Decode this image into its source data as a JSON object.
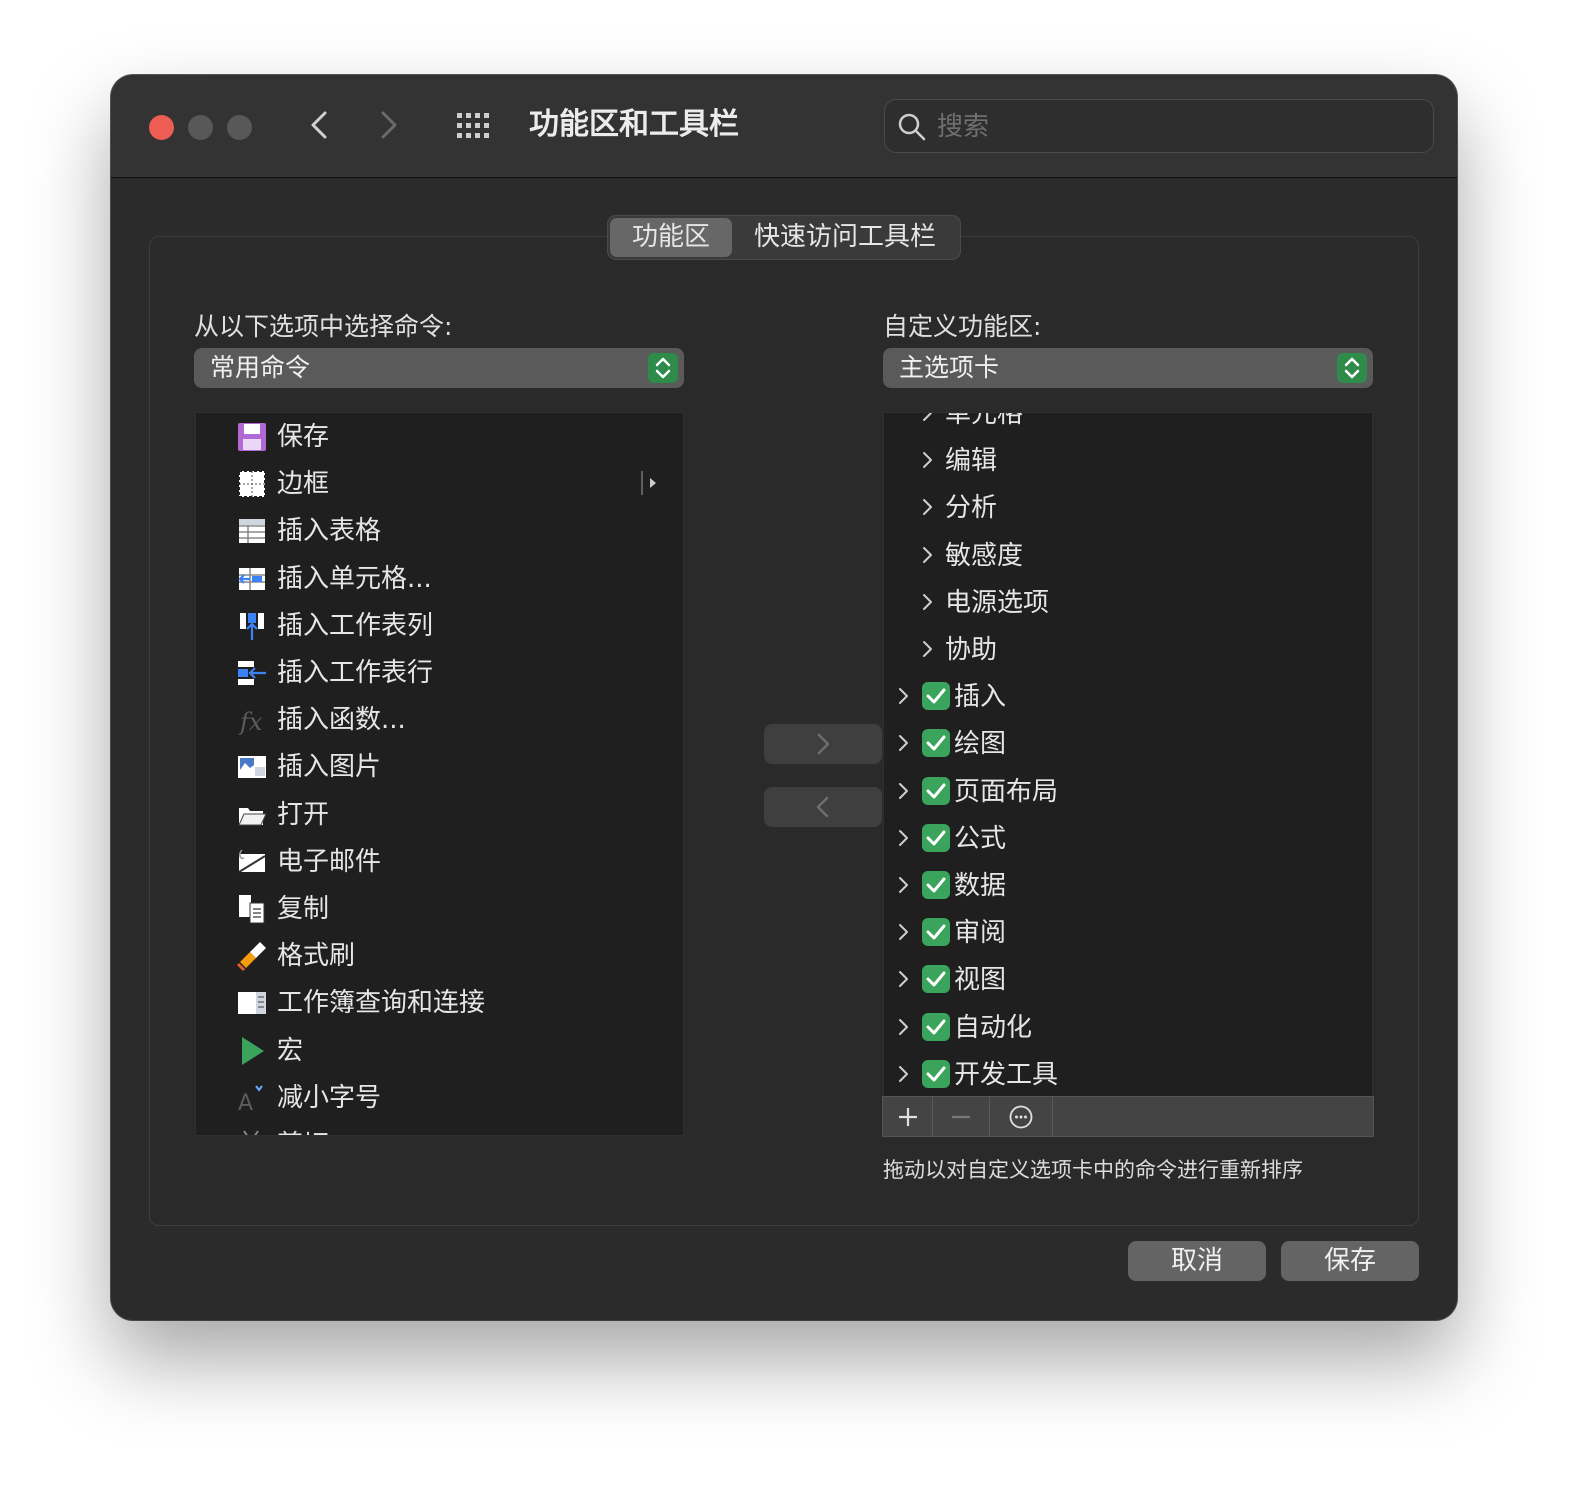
{
  "window": {
    "title": "功能区和工具栏",
    "search_placeholder": "搜索"
  },
  "tabs": [
    {
      "label": "功能区",
      "active": true
    },
    {
      "label": "快速访问工具栏",
      "active": false
    }
  ],
  "left": {
    "label": "从以下选项中选择命令:",
    "select_value": "常用命令",
    "commands": [
      {
        "label": "保存",
        "icon": "save-icon"
      },
      {
        "label": "边框",
        "icon": "borders-icon",
        "submenu": true
      },
      {
        "label": "插入表格",
        "icon": "insert-table-icon"
      },
      {
        "label": "插入单元格...",
        "icon": "insert-cells-icon"
      },
      {
        "label": "插入工作表列",
        "icon": "insert-sheet-column-icon"
      },
      {
        "label": "插入工作表行",
        "icon": "insert-sheet-row-icon"
      },
      {
        "label": "插入函数...",
        "icon": "insert-function-icon"
      },
      {
        "label": "插入图片",
        "icon": "insert-picture-icon"
      },
      {
        "label": "打开",
        "icon": "open-folder-icon"
      },
      {
        "label": "电子邮件",
        "icon": "email-icon"
      },
      {
        "label": "复制",
        "icon": "copy-icon"
      },
      {
        "label": "格式刷",
        "icon": "format-painter-icon"
      },
      {
        "label": "工作簿查询和连接",
        "icon": "queries-connections-icon"
      },
      {
        "label": "宏",
        "icon": "macro-play-icon"
      },
      {
        "label": "减小字号",
        "icon": "decrease-font-size-icon"
      },
      {
        "label": "剪切",
        "icon": "cut-icon"
      }
    ]
  },
  "right": {
    "label": "自定义功能区:",
    "select_value": "主选项卡",
    "groups": [
      {
        "label": "单元格",
        "level": 2
      },
      {
        "label": "编辑",
        "level": 2
      },
      {
        "label": "分析",
        "level": 2
      },
      {
        "label": "敏感度",
        "level": 2
      },
      {
        "label": "电源选项",
        "level": 2
      },
      {
        "label": "协助",
        "level": 2
      },
      {
        "label": "插入",
        "level": 1,
        "checked": true
      },
      {
        "label": "绘图",
        "level": 1,
        "checked": true
      },
      {
        "label": "页面布局",
        "level": 1,
        "checked": true
      },
      {
        "label": "公式",
        "level": 1,
        "checked": true
      },
      {
        "label": "数据",
        "level": 1,
        "checked": true
      },
      {
        "label": "审阅",
        "level": 1,
        "checked": true
      },
      {
        "label": "视图",
        "level": 1,
        "checked": true
      },
      {
        "label": "自动化",
        "level": 1,
        "checked": true
      },
      {
        "label": "开发工具",
        "level": 1,
        "checked": true
      }
    ],
    "hint": "拖动以对自定义选项卡中的命令进行重新排序"
  },
  "buttons": {
    "cancel": "取消",
    "save": "保存"
  },
  "colors": {
    "close": "#ee5d53",
    "accent_green": "#3aa35c",
    "window_bg": "#2b2b2b"
  }
}
